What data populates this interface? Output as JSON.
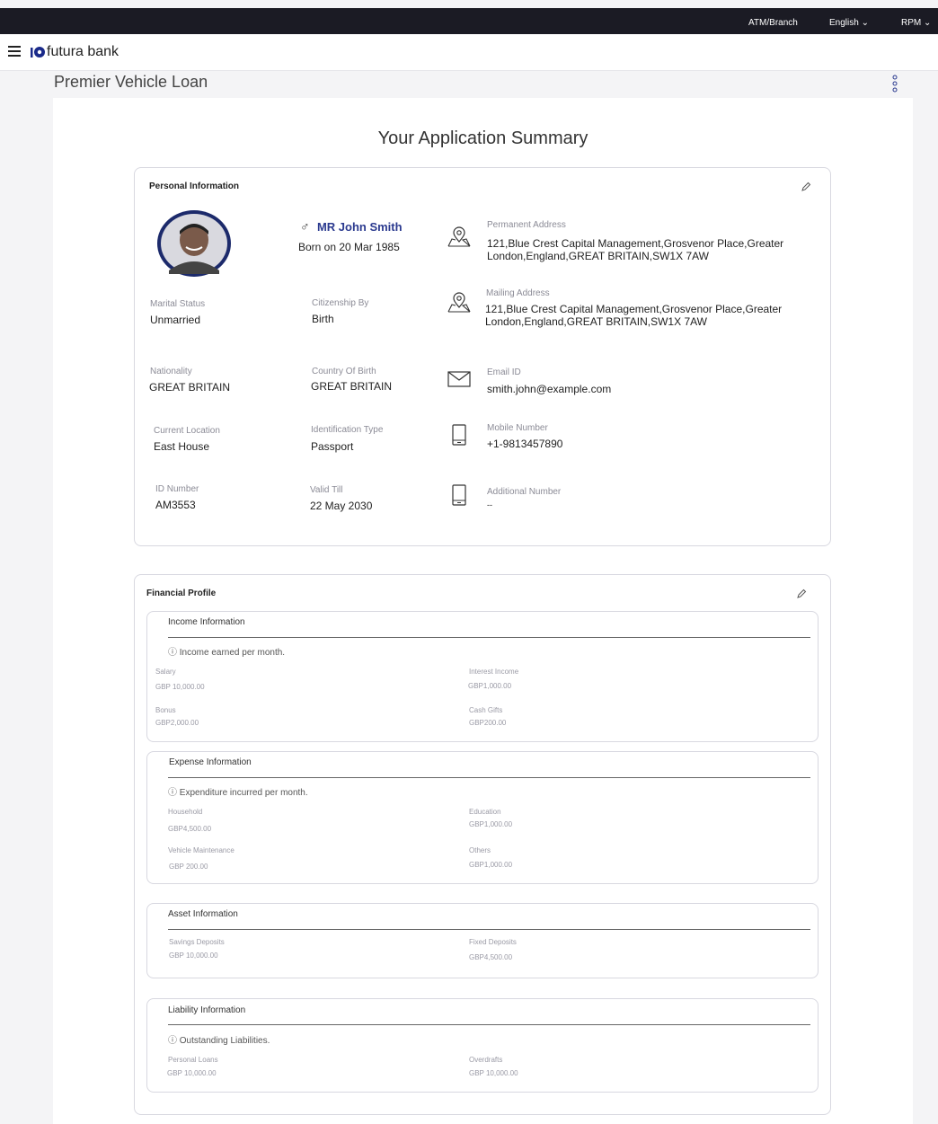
{
  "topbar": {
    "atm_branch": "ATM/Branch",
    "language": "English",
    "user": "RPM"
  },
  "header": {
    "brand": "futura bank"
  },
  "page": {
    "title": "Premier Vehicle Loan",
    "summary_title": "Your Application Summary"
  },
  "personal": {
    "title": "Personal Information",
    "name": "MR John Smith",
    "born": "Born on 20 Mar 1985",
    "marital_label": "Marital Status",
    "marital_value": "Unmarried",
    "citizenship_label": "Citizenship By",
    "citizenship_value": "Birth",
    "nationality_label": "Nationality",
    "nationality_value": "GREAT BRITAIN",
    "cob_label": "Country Of Birth",
    "cob_value": "GREAT BRITAIN",
    "location_label": "Current Location",
    "location_value": "East House",
    "idtype_label": "Identification Type",
    "idtype_value": "Passport",
    "idnum_label": "ID Number",
    "idnum_value": "AM3553",
    "valid_label": "Valid Till",
    "valid_value": "22 May 2030",
    "perm_label": "Permanent Address",
    "perm_line1": "121,Blue Crest Capital Management,Grosvenor Place,Greater",
    "perm_line2": "London,England,GREAT BRITAIN,SW1X 7AW",
    "mail_label": "Mailing Address",
    "mail_line1": "121,Blue Crest Capital Management,Grosvenor Place,Greater",
    "mail_line2": "London,England,GREAT BRITAIN,SW1X 7AW",
    "email_label": "Email ID",
    "email_value": "smith.john@example.com",
    "mobile_label": "Mobile Number",
    "mobile_value": "+1-9813457890",
    "addl_label": "Additional Number",
    "addl_value": "--"
  },
  "financial": {
    "title": "Financial Profile",
    "income": {
      "title": "Income Information",
      "note": "Income earned per month.",
      "salary_label": "Salary",
      "salary_value": "GBP 10,000.00",
      "interest_label": "Interest Income",
      "interest_value": "GBP1,000.00",
      "bonus_label": "Bonus",
      "bonus_value": "GBP2,000.00",
      "gifts_label": "Cash Gifts",
      "gifts_value": "GBP200.00"
    },
    "expense": {
      "title": "Expense Information",
      "note": "Expenditure incurred per month.",
      "household_label": "Household",
      "household_value": "GBP4,500.00",
      "education_label": "Education",
      "education_value": "GBP1,000.00",
      "vehicle_label": "Vehicle Maintenance",
      "vehicle_value": "GBP 200.00",
      "others_label": "Others",
      "others_value": "GBP1,000.00"
    },
    "asset": {
      "title": "Asset Information",
      "savings_label": "Savings Deposits",
      "savings_value": "GBP 10,000.00",
      "fixed_label": "Fixed Deposits",
      "fixed_value": "GBP4,500.00"
    },
    "liability": {
      "title": "Liability Information",
      "note": "Outstanding Liabilities.",
      "personal_label": "Personal Loans",
      "personal_value": "GBP 10,000.00",
      "overdraft_label": "Overdrafts",
      "overdraft_value": "GBP 10,000.00"
    }
  },
  "colors": {
    "topbar": "#1b1b24",
    "accent": "#2b3a8f"
  }
}
